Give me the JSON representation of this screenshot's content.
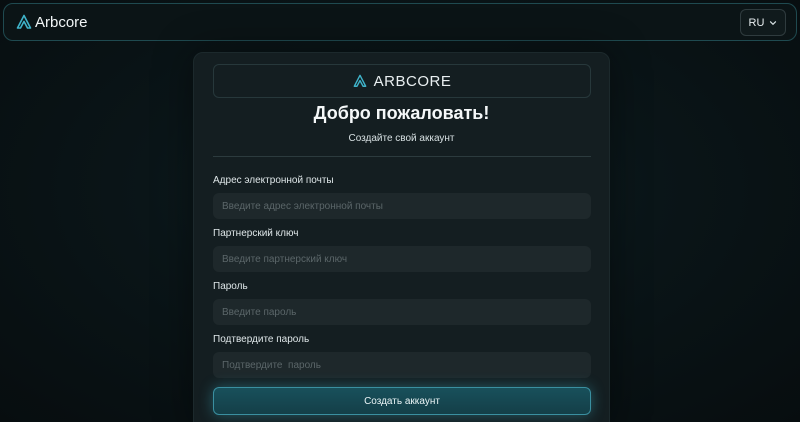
{
  "navbar": {
    "brand": "Arbcore",
    "logo_icon": "arbcore-logo-icon",
    "language": "RU",
    "language_icon": "chevron-down-icon"
  },
  "card": {
    "brand": "ARBCORE",
    "title": "Добро пожаловать!",
    "subtitle": "Создайте свой аккаунт",
    "fields": [
      {
        "label": "Адрес электронной почты",
        "placeholder": "Введите адрес электронной почты",
        "value": ""
      },
      {
        "label": "Партнерский ключ",
        "placeholder": "Введите партнерский ключ",
        "value": ""
      },
      {
        "label": "Пароль",
        "placeholder": "Введите пароль",
        "value": ""
      },
      {
        "label": "Подтвердите пароль",
        "placeholder": "Подтвердите  пароль",
        "value": ""
      }
    ],
    "submit_label": "Создать аккаунт"
  },
  "colors": {
    "accent": "#3aa6b9",
    "background": "#0a1518",
    "card": "#141e21",
    "input": "#1e282b"
  }
}
